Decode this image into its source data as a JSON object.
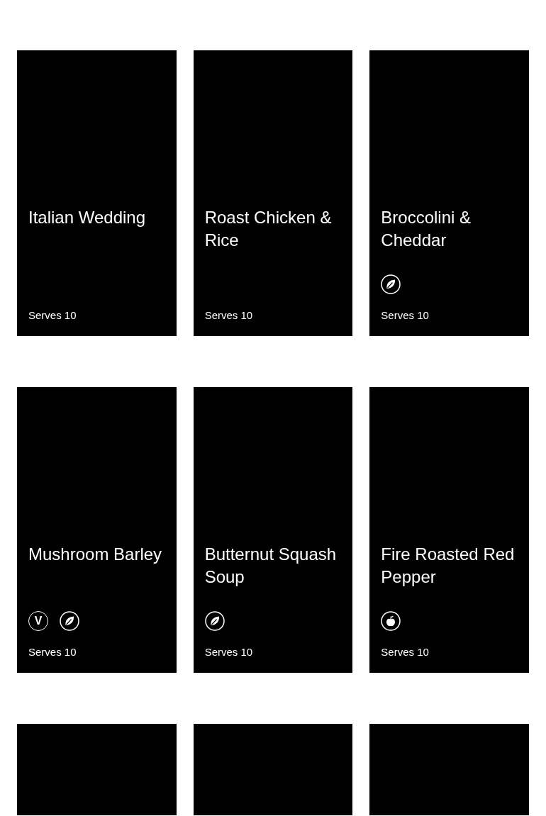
{
  "cards": [
    {
      "kind": "recipe",
      "title": "Italian Wedding",
      "serves": "Serves 10"
    },
    {
      "kind": "recipe",
      "title": "Roast Chicken & Rice",
      "serves": "Serves 10"
    },
    {
      "kind": "recipe",
      "title": "Broccolini & Cheddar",
      "badges": [
        {
          "kind": "leaf"
        }
      ],
      "serves": "Serves 10"
    },
    {
      "kind": "recipe",
      "title": "Mushroom Barley",
      "badges": [
        {
          "kind": "letter",
          "text": "V"
        },
        {
          "kind": "leaf"
        }
      ],
      "serves": "Serves 10"
    },
    {
      "kind": "recipe",
      "title": "Butternut Squash Soup",
      "badges": [
        {
          "kind": "leaf"
        }
      ],
      "serves": "Serves 10"
    },
    {
      "kind": "recipe",
      "title": "Fire Roasted Red Pepper",
      "badges": [
        {
          "kind": "apple"
        }
      ],
      "serves": "Serves 10"
    },
    {
      "kind": "cut_off"
    },
    {
      "kind": "cut_off"
    },
    {
      "kind": "cut_off"
    }
  ]
}
